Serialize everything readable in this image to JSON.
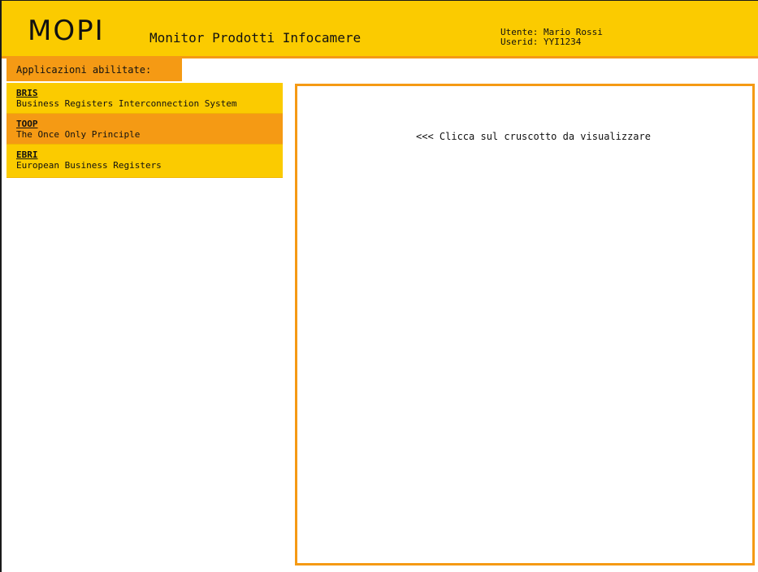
{
  "header": {
    "logo": "MOPI",
    "title": "Monitor Prodotti Infocamere",
    "user_label": "Utente: Mario Rossi",
    "userid_label": "Userid: YYI1234"
  },
  "sidebar": {
    "heading": "Applicazioni abilitate:",
    "items": [
      {
        "code": "BRIS",
        "description": "Business Registers Interconnection System",
        "active": false
      },
      {
        "code": "TOOP",
        "description": "The Once Only Principle",
        "active": true
      },
      {
        "code": "EBRI",
        "description": "European Business Registers",
        "active": false
      }
    ]
  },
  "main": {
    "hint": "<<< Clicca sul cruscotto da visualizzare"
  },
  "colors": {
    "header_bg": "#fbcb00",
    "accent_orange": "#f59a14"
  }
}
